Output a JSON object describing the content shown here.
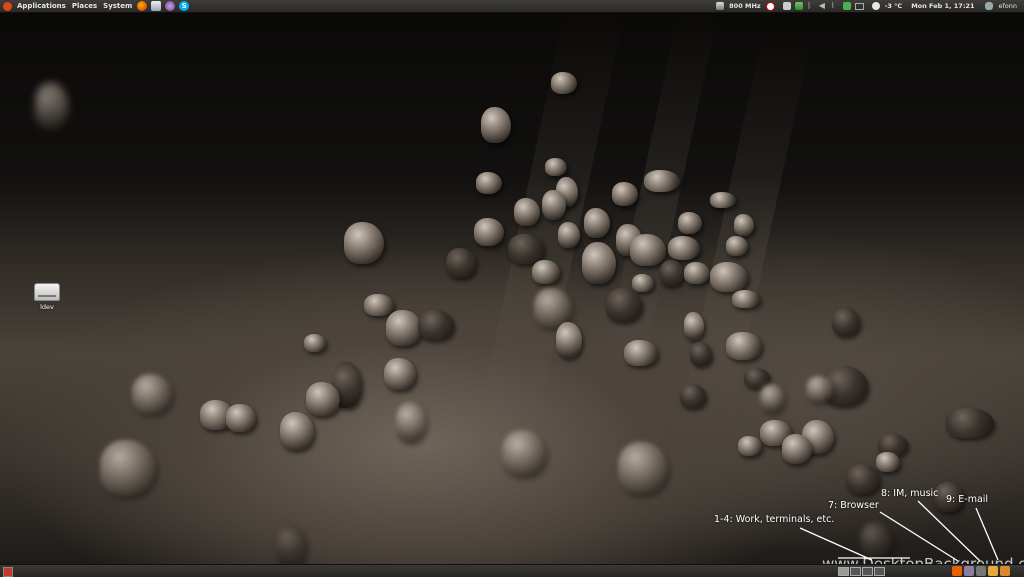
{
  "top_panel": {
    "menus": [
      "Applications",
      "Places",
      "System"
    ],
    "launchers": [
      "firefox-icon",
      "mail-icon",
      "pidgin-icon",
      "skype-icon"
    ],
    "cpu_freq": "800 MHz",
    "weather": "-3 °C",
    "clock": "Mon Feb  1, 17:21",
    "user": "efonn"
  },
  "desktop": {
    "icons": [
      {
        "label": "ldev",
        "icon": "drive-icon"
      }
    ]
  },
  "annotations": {
    "workspaces": "1-4: Work, terminals, etc.",
    "browser": "7: Browser",
    "im": "8: IM, music",
    "email": "9: E-mail"
  },
  "watermark": "www.DesktopBackground.org",
  "colors": {
    "panel": "#2f2e2b",
    "ubuntu_logo": "#dd4814",
    "firefox": "#e66000",
    "skype": "#00aff0"
  }
}
